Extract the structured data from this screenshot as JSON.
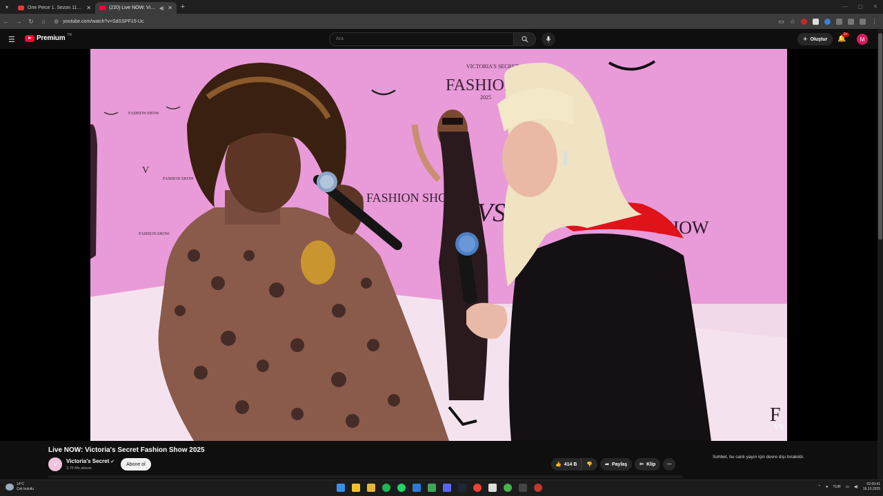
{
  "browser": {
    "tabs": [
      {
        "title": "One Piece 1. Sezon 1102. Bölüm",
        "active": false
      },
      {
        "title": "(220) Live NOW: Victoria's Secret",
        "active": true
      }
    ],
    "url": "youtube.com/watch?v=SdSSPF15-Uc"
  },
  "youtube": {
    "logo_text": "Premium",
    "logo_country": "TR",
    "search_placeholder": "Ara",
    "create_label": "Oluştur",
    "notifications_badge": "9+",
    "avatar_letter": "M"
  },
  "video": {
    "backdrop_text_1": "VICTORIA'S SECRET",
    "backdrop_text_2": "FASHION SHOW",
    "backdrop_text_3": "2025",
    "backdrop_text_4": "FASHION SHOW",
    "backdrop_text_5": "SHOW",
    "watermark": "VS"
  },
  "info": {
    "title": "Live NOW: Victoria's Secret Fashion Show 2025",
    "channel_name": "Victoria's Secret",
    "subscribers": "3,76 Mn abone",
    "subscribe_label": "Abone ol",
    "likes": "414 B",
    "share_label": "Paylaş",
    "clip_label": "Klip",
    "chat_note": "Sohbet, bu canlı yayın için devre dışı bırakıldı."
  },
  "taskbar": {
    "temperature": "14°C",
    "weather_desc": "Çok bulutlu",
    "language": "TUR",
    "time": "02:00:41",
    "date": "16.10.2025"
  },
  "colors": {
    "backdrop_pink": "#e79ad7",
    "youtube_red": "#ff0033",
    "scarf_red": "#e0121a"
  }
}
